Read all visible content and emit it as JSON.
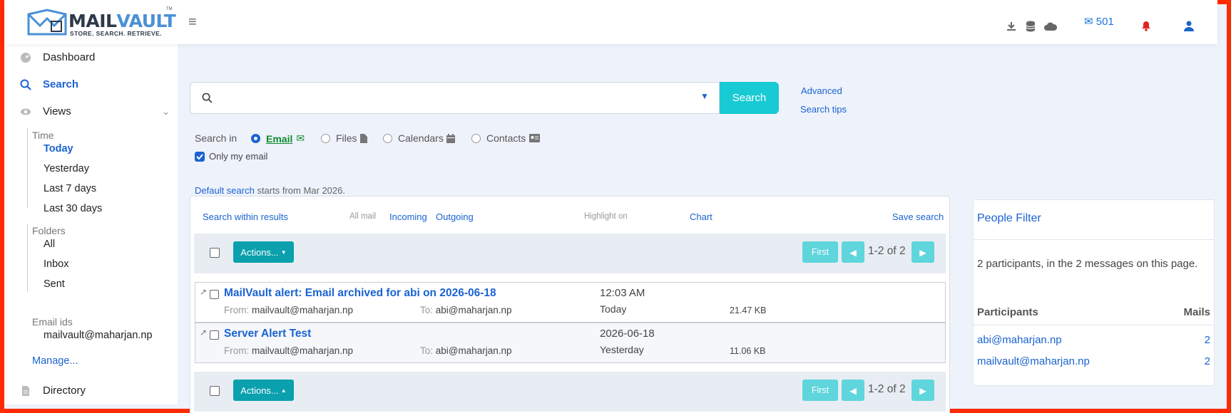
{
  "header": {
    "logo": {
      "word_a": "MAIL",
      "word_b": "VAULT",
      "tagline": "STORE. SEARCH. RETRIEVE.",
      "tm": "TM"
    },
    "mail_count": "501"
  },
  "sidebar": {
    "dashboard": "Dashboard",
    "search": "Search",
    "views": "Views",
    "time_label": "Time",
    "time_items": [
      "Today",
      "Yesterday",
      "Last 7 days",
      "Last 30 days"
    ],
    "folders_label": "Folders",
    "folder_items": [
      "All",
      "Inbox",
      "Sent"
    ],
    "email_ids_label": "Email ids",
    "email_id": "mailvault@maharjan.np",
    "manage": "Manage...",
    "directory": "Directory"
  },
  "search": {
    "placeholder": "",
    "button": "Search",
    "advanced": "Advanced",
    "tips": "Search tips",
    "search_in_label": "Search in",
    "options": [
      {
        "label": "Email",
        "selected": true
      },
      {
        "label": "Files",
        "selected": false
      },
      {
        "label": "Calendars",
        "selected": false
      },
      {
        "label": "Contacts",
        "selected": false
      }
    ],
    "only_my_email": "Only my email",
    "default_link": "Default search",
    "default_rest": " starts from Mar 2026."
  },
  "results": {
    "within": "Search within results",
    "all_mail": "All mail",
    "incoming": "Incoming",
    "outgoing": "Outgoing",
    "highlight": "Highlight on",
    "chart": "Chart",
    "save": "Save search",
    "actions": "Actions...",
    "first": "First",
    "range": "1-2 of 2",
    "from_label": "From:",
    "to_label": "To:",
    "messages": [
      {
        "subject": "MailVault alert: Email archived for abi on 2026-06-18",
        "from": "mailvault@maharjan.np",
        "to": "abi@maharjan.np",
        "time": "12:03 AM",
        "day": "Today",
        "size": "21.47 KB"
      },
      {
        "subject": "Server Alert Test",
        "from": "mailvault@maharjan.np",
        "to": "abi@maharjan.np",
        "time": "2026-06-18",
        "day": "Yesterday",
        "size": "11.06 KB"
      }
    ]
  },
  "people": {
    "title": "People Filter",
    "summary": "2 participants, in the 2 messages on this page.",
    "col_participants": "Participants",
    "col_mails": "Mails",
    "rows": [
      {
        "email": "abi@maharjan.np",
        "count": "2"
      },
      {
        "email": "mailvault@maharjan.np",
        "count": "2"
      }
    ]
  },
  "colors": {
    "accent": "#17cad3",
    "link": "#1a63d0",
    "border": "#ff2a00"
  }
}
